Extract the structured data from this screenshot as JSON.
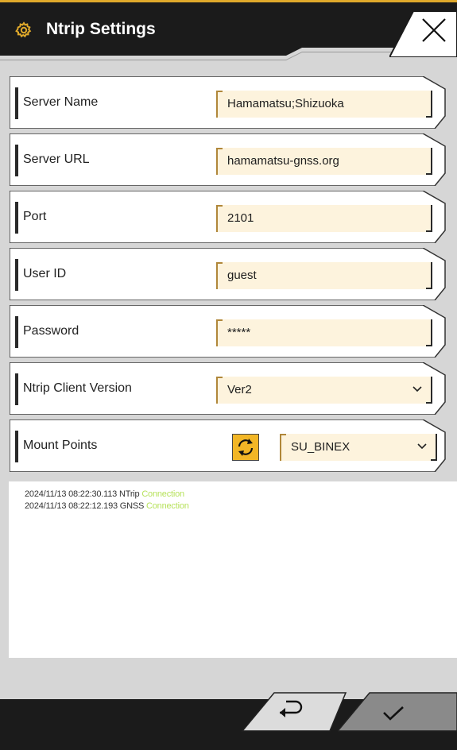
{
  "header": {
    "title": "Ntrip Settings",
    "icon": "gear-icon",
    "accent": "#e0a92b"
  },
  "settings": {
    "rows": [
      {
        "label": "Server Name",
        "value": "Hamamatsu;Shizuoka"
      },
      {
        "label": "Server URL",
        "value": "hamamatsu-gnss.org"
      },
      {
        "label": "Port",
        "value": "2101"
      },
      {
        "label": "User ID",
        "value": "guest"
      },
      {
        "label": "Password",
        "value": "*****"
      },
      {
        "label": "Ntrip Client Version",
        "value": "Ver2"
      },
      {
        "label": "Mount Points",
        "value": "SU_BINEX"
      }
    ]
  },
  "log": {
    "lines": [
      {
        "text": "2024/11/13 08:22:30.113 NTrip",
        "status": "Connection"
      },
      {
        "text": "2024/11/13 08:22:12.193 GNSS",
        "status": "Connection"
      }
    ],
    "status_color": "#b7e25c"
  },
  "footer": {
    "back_icon": "return-arrow-icon",
    "confirm_icon": "checkmark-icon"
  }
}
